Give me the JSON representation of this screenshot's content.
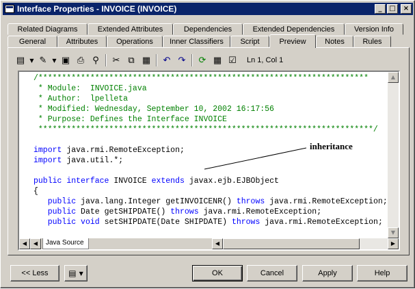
{
  "window": {
    "title": "Interface Properties - INVOICE (INVOICE)"
  },
  "titlebar_buttons": {
    "minimize": "_",
    "maximize": "□",
    "close": "×"
  },
  "tabs_row1": [
    "Related Diagrams",
    "Extended Attributes",
    "Dependencies",
    "Extended Dependencies",
    "Version Info"
  ],
  "tabs_row2": [
    "General",
    "Attributes",
    "Operations",
    "Inner Classifiers",
    "Script",
    "Preview",
    "Notes",
    "Rules"
  ],
  "active_tab": "Preview",
  "toolbar": {
    "cursor_position": "Ln 1, Col 1"
  },
  "editor": {
    "lines": [
      {
        "t": "/**********************************************************************",
        "c": "cm"
      },
      {
        "t": " * Module:  INVOICE.java",
        "c": "cm"
      },
      {
        "t": " * Author:  lpelleta",
        "c": "cm"
      },
      {
        "t": " * Modified: Wednesday, September 10, 2002 16:17:56",
        "c": "cm"
      },
      {
        "t": " * Purpose: Defines the Interface INVOICE",
        "c": "cm"
      },
      {
        "t": " ***********************************************************************/",
        "c": "cm"
      },
      {
        "t": "",
        "c": ""
      },
      {
        "t": "import java.rmi.RemoteException;",
        "c": ""
      },
      {
        "t": "import java.util.*;",
        "c": ""
      },
      {
        "t": "",
        "c": ""
      },
      {
        "t": "public interface INVOICE extends javax.ejb.EJBObject",
        "c": ""
      },
      {
        "t": "{",
        "c": ""
      },
      {
        "t": "   public java.lang.Integer getINVOICENR() throws java.rmi.RemoteException;",
        "c": ""
      },
      {
        "t": "   public Date getSHIPDATE() throws java.rmi.RemoteException;",
        "c": ""
      },
      {
        "t": "   public void setSHIPDATE(Date SHIPDATE) throws java.rmi.RemoteException;",
        "c": ""
      },
      {
        "t": "",
        "c": ""
      },
      {
        "t": "}",
        "c": ""
      }
    ],
    "keywords": [
      "import",
      "public",
      "interface",
      "extends",
      "throws",
      "void"
    ],
    "source_tab": "Java Source"
  },
  "annotation": {
    "label": "inheritance"
  },
  "buttons": {
    "less": "<< Less",
    "ok": "OK",
    "cancel": "Cancel",
    "apply": "Apply",
    "help": "Help"
  },
  "colors": {
    "titlebar": "#0a246a",
    "comment": "#008000",
    "keyword": "#0000ff",
    "face": "#d4d0c8"
  }
}
